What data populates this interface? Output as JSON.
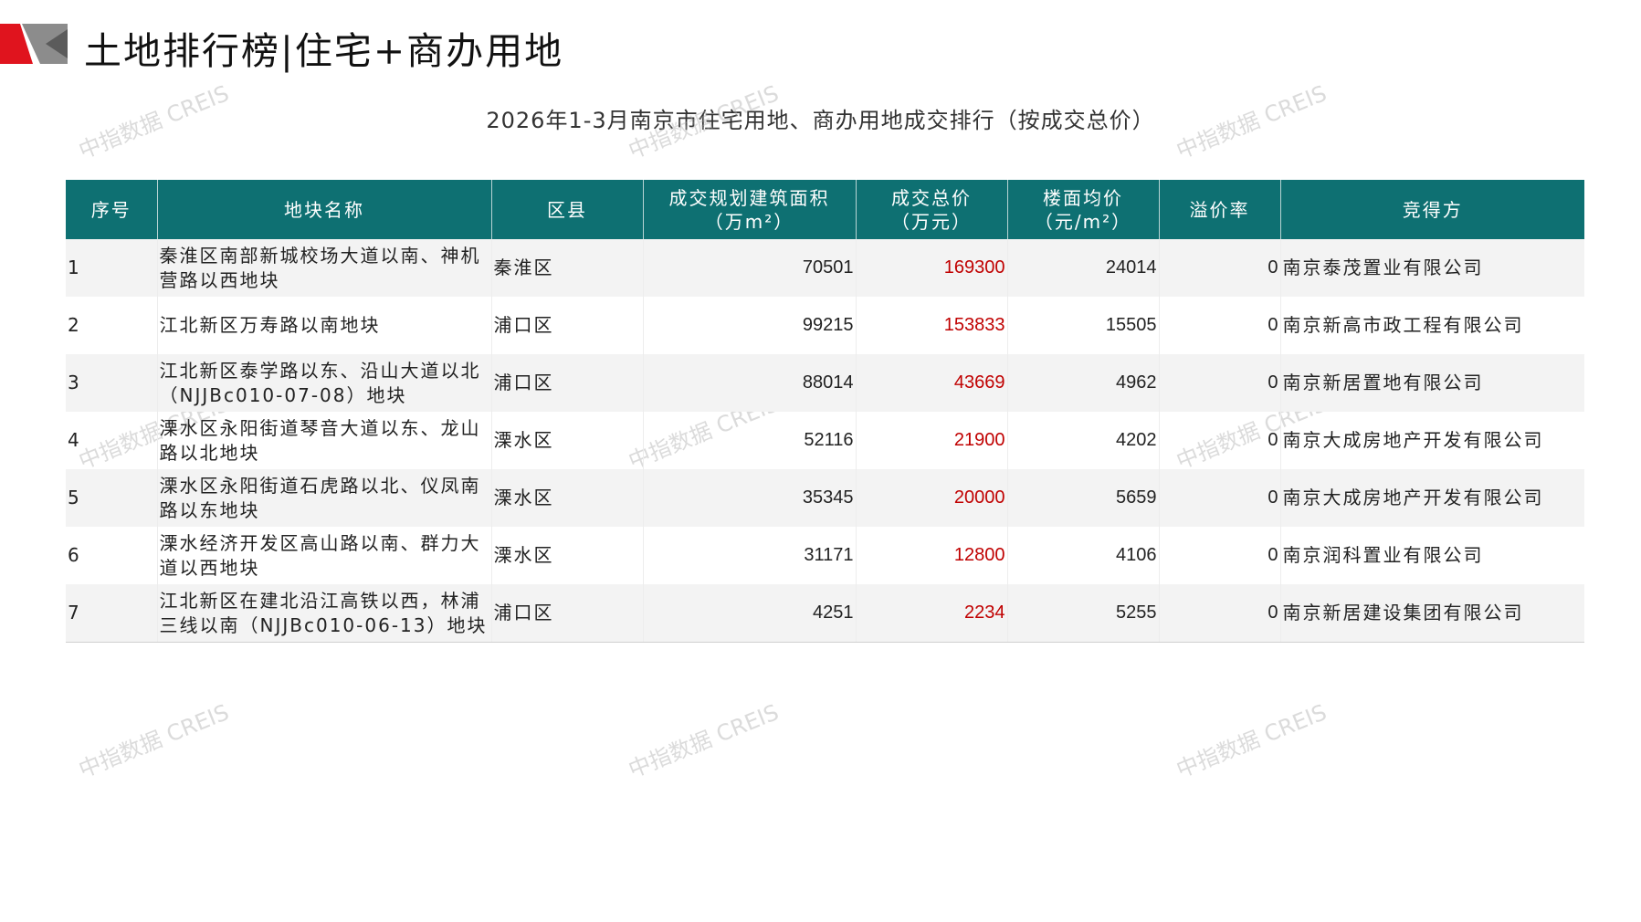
{
  "page": {
    "title": "土地排行榜|住宅+商办用地",
    "table_title": "2026年1-3月南京市住宅用地、商办用地成交排行（按成交总价）",
    "watermark": "中指数据 CREIS"
  },
  "colors": {
    "header_bg": "#0e7072",
    "accent_red": "#c00000",
    "logo_red": "#e0141e",
    "logo_gray": "#8c8c8c"
  },
  "table": {
    "headers": [
      {
        "line1": "序号",
        "line2": ""
      },
      {
        "line1": "地块名称",
        "line2": ""
      },
      {
        "line1": "区县",
        "line2": ""
      },
      {
        "line1": "成交规划建筑面积",
        "line2": "（万m²）"
      },
      {
        "line1": "成交总价",
        "line2": "（万元）"
      },
      {
        "line1": "楼面均价",
        "line2": "（元/m²）"
      },
      {
        "line1": "溢价率",
        "line2": ""
      },
      {
        "line1": "竞得方",
        "line2": ""
      }
    ],
    "rows": [
      {
        "rank": "1",
        "name": "秦淮区南部新城校场大道以南、神机营路以西地块",
        "district": "秦淮区",
        "area": "70501",
        "total": "169300",
        "unit_price": "24014",
        "premium": "0",
        "winner": "南京泰茂置业有限公司"
      },
      {
        "rank": "2",
        "name": "江北新区万寿路以南地块",
        "district": "浦口区",
        "area": "99215",
        "total": "153833",
        "unit_price": "15505",
        "premium": "0",
        "winner": "南京新高市政工程有限公司"
      },
      {
        "rank": "3",
        "name": "江北新区泰学路以东、沿山大道以北（NJJBc010-07-08）地块",
        "district": "浦口区",
        "area": "88014",
        "total": "43669",
        "unit_price": "4962",
        "premium": "0",
        "winner": "南京新居置地有限公司"
      },
      {
        "rank": "4",
        "name": "溧水区永阳街道琴音大道以东、龙山路以北地块",
        "district": "溧水区",
        "area": "52116",
        "total": "21900",
        "unit_price": "4202",
        "premium": "0",
        "winner": "南京大成房地产开发有限公司"
      },
      {
        "rank": "5",
        "name": "溧水区永阳街道石虎路以北、仪凤南路以东地块",
        "district": "溧水区",
        "area": "35345",
        "total": "20000",
        "unit_price": "5659",
        "premium": "0",
        "winner": "南京大成房地产开发有限公司"
      },
      {
        "rank": "6",
        "name": "溧水经济开发区高山路以南、群力大道以西地块",
        "district": "溧水区",
        "area": "31171",
        "total": "12800",
        "unit_price": "4106",
        "premium": "0",
        "winner": "南京润科置业有限公司"
      },
      {
        "rank": "7",
        "name": "江北新区在建北沿江高铁以西，林浦三线以南（NJJBc010-06-13）地块",
        "district": "浦口区",
        "area": "4251",
        "total": "2234",
        "unit_price": "5255",
        "premium": "0",
        "winner": "南京新居建设集团有限公司"
      }
    ]
  }
}
